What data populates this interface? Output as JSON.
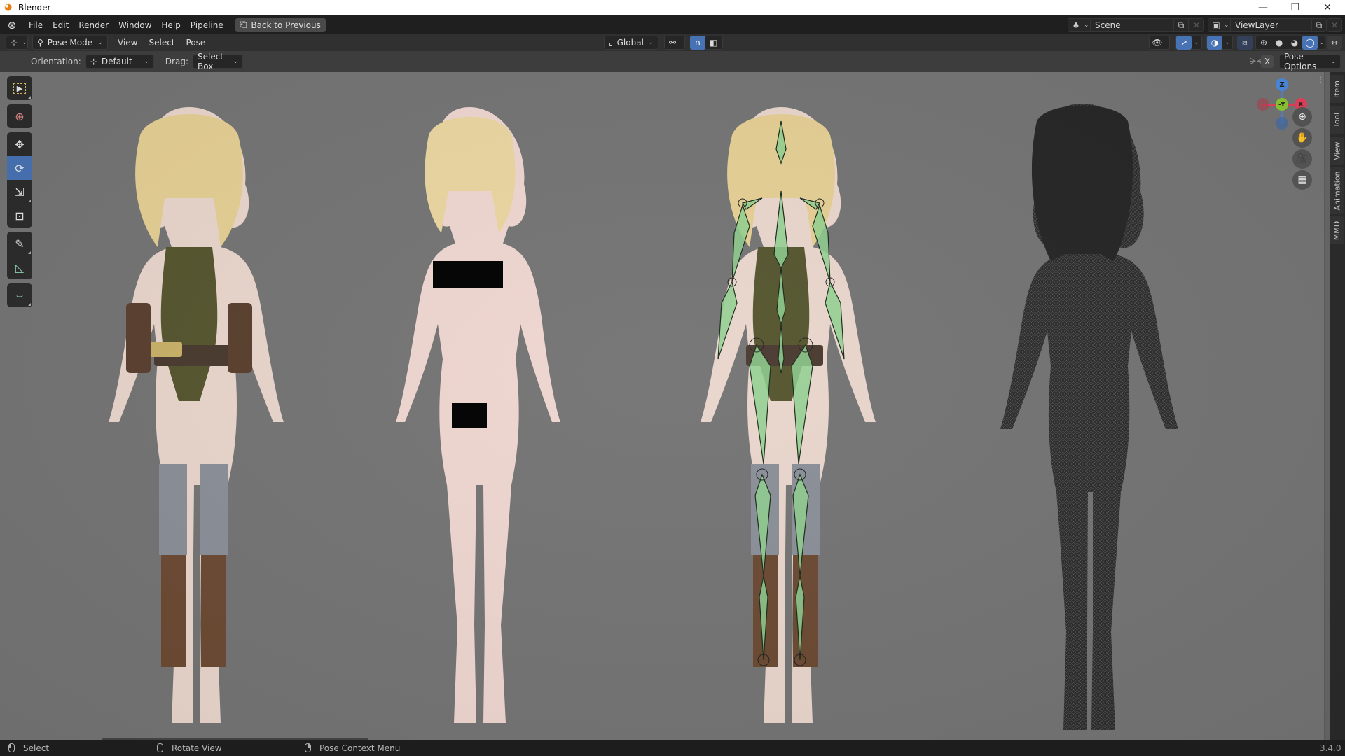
{
  "window": {
    "title": "Blender",
    "controls": {
      "minimize": "—",
      "restore": "❐",
      "close": "✕"
    }
  },
  "topbar": {
    "menus": [
      "File",
      "Edit",
      "Render",
      "Window",
      "Help",
      "Pipeline"
    ],
    "back_button": "Back to Previous",
    "scene": {
      "label": "Scene"
    },
    "view_layer": {
      "label": "ViewLayer"
    }
  },
  "header": {
    "editor_type_icon": "3d-viewport-icon",
    "mode": "Pose Mode",
    "menus": [
      "View",
      "Select",
      "Pose"
    ],
    "transform_orientation": "Global",
    "shading_modes": [
      "wireframe",
      "solid",
      "material-preview",
      "rendered"
    ],
    "active_shading": "rendered"
  },
  "tool_settings": {
    "orientation_label": "Orientation:",
    "orientation_value": "Default",
    "drag_label": "Drag:",
    "drag_value": "Select Box",
    "x_mirror": "X",
    "pose_options": "Pose Options"
  },
  "toolbar": {
    "tools": [
      {
        "name": "select-box",
        "icon": "▸",
        "active": false
      },
      {
        "name": "cursor",
        "icon": "⊕",
        "active": false
      },
      {
        "name": "move",
        "icon": "✥",
        "active": false
      },
      {
        "name": "rotate",
        "icon": "⟳",
        "active": true
      },
      {
        "name": "scale",
        "icon": "⬚",
        "active": false
      },
      {
        "name": "transform",
        "icon": "◈",
        "active": false
      },
      {
        "name": "annotate",
        "icon": "✎",
        "active": false
      },
      {
        "name": "measure",
        "icon": "📐",
        "active": false
      },
      {
        "name": "relax-pose",
        "icon": "⌄",
        "active": false
      }
    ]
  },
  "gizmo": {
    "z_label": "Z",
    "y_label": "-Y",
    "x_label": "X",
    "colors": {
      "x": "#e4405a",
      "y": "#8bc830",
      "z": "#4a8ae0"
    }
  },
  "side_tabs": [
    "Item",
    "Tool",
    "View",
    "Animation",
    "MMD"
  ],
  "status_bar": {
    "left_mouse": "Select",
    "middle_mouse": "Rotate View",
    "right_mouse": "Pose Context Menu",
    "version": "3.4.0"
  }
}
